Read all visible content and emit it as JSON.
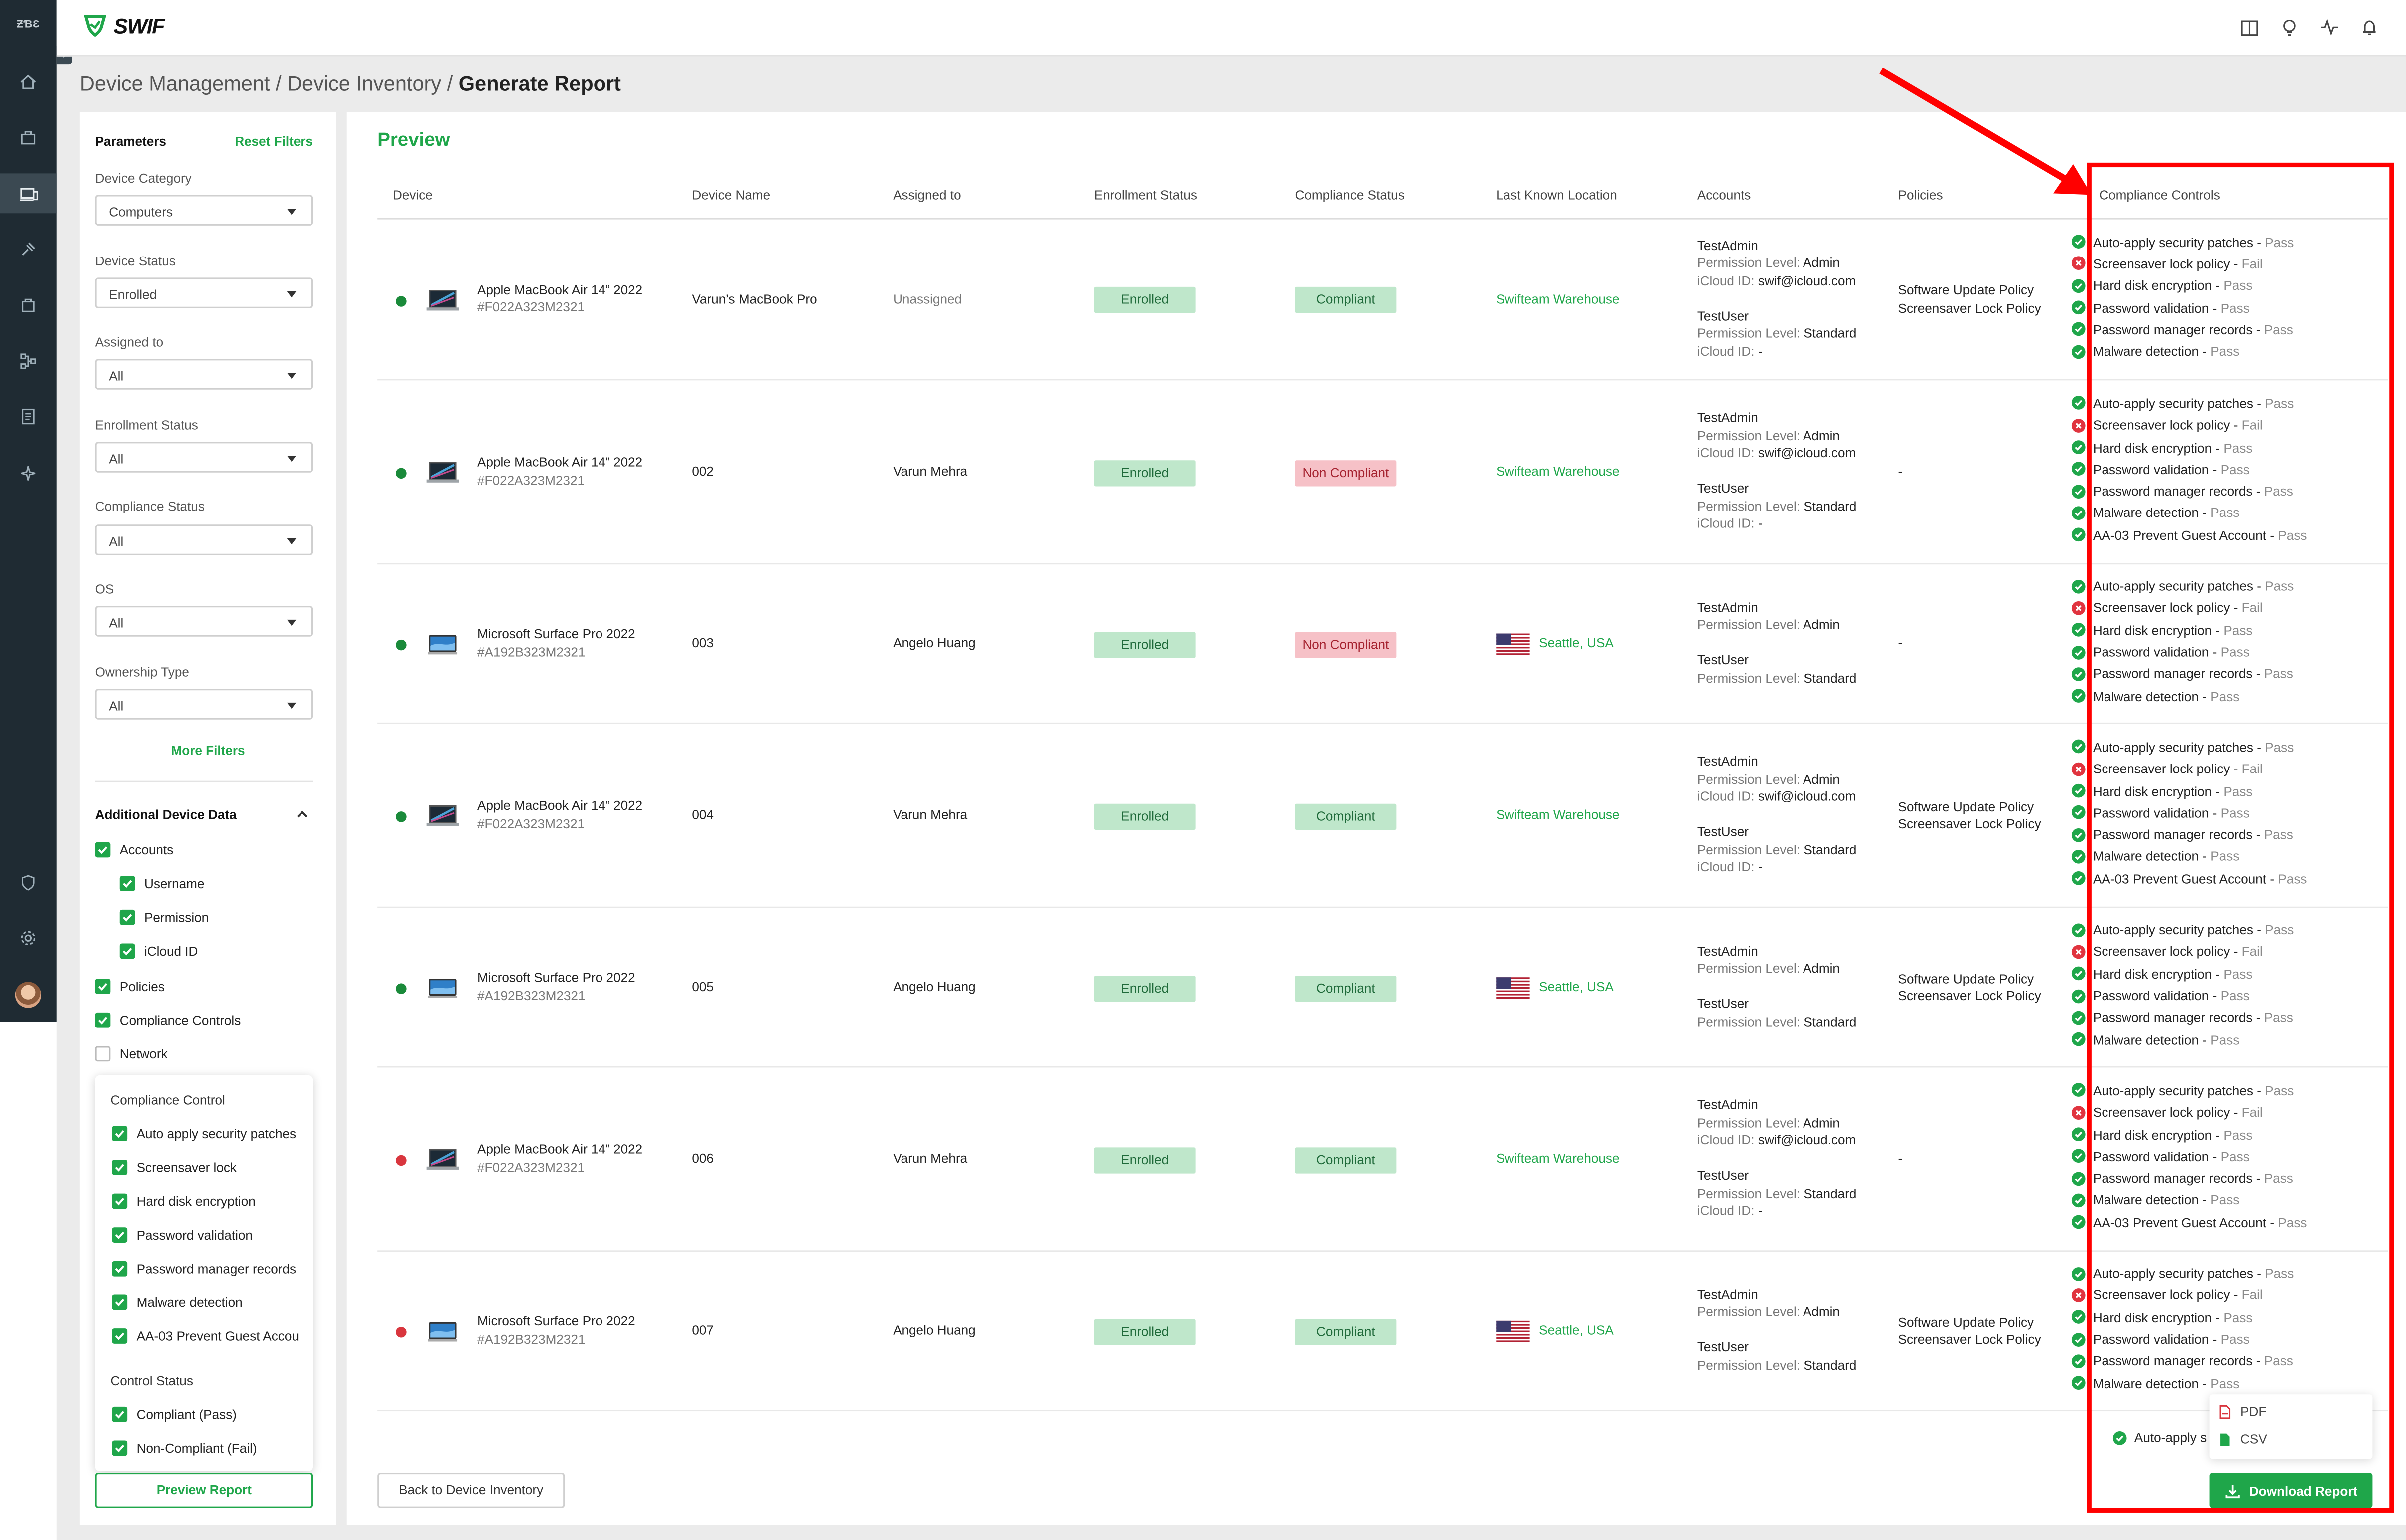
{
  "rail": {
    "org": "ƵƁƐ",
    "items": [
      "home-icon",
      "toolbox-icon",
      "devices-icon",
      "gavel-icon",
      "bag-icon",
      "network-icon",
      "report-icon",
      "sparkle-icon"
    ],
    "bottom": [
      "shield-lock-icon",
      "gear-icon",
      "avatar"
    ]
  },
  "topbar": {
    "logo": "SWIF",
    "icons": [
      "book-icon",
      "bulb-icon",
      "activity-icon",
      "bell-icon"
    ]
  },
  "breadcrumb": {
    "part1": "Device Management / Device Inventory / ",
    "current": "Generate Report"
  },
  "params": {
    "title": "Parameters",
    "reset": "Reset Filters",
    "filters": [
      {
        "label": "Device Category",
        "value": "Computers"
      },
      {
        "label": "Device Status",
        "value": "Enrolled"
      },
      {
        "label": "Assigned to",
        "value": "All"
      },
      {
        "label": "Enrollment Status",
        "value": "All"
      },
      {
        "label": "Compliance Status",
        "value": "All"
      },
      {
        "label": "OS",
        "value": "All"
      },
      {
        "label": "Ownership Type",
        "value": "All"
      }
    ],
    "more_filters": "More Filters",
    "additional_title": "Additional Device Data",
    "additional": [
      {
        "label": "Accounts",
        "checked": true,
        "indent": false
      },
      {
        "label": "Username",
        "checked": true,
        "indent": true
      },
      {
        "label": "Permission",
        "checked": true,
        "indent": true
      },
      {
        "label": "iCloud ID",
        "checked": true,
        "indent": true
      },
      {
        "label": "Policies",
        "checked": true,
        "indent": false
      },
      {
        "label": "Compliance Controls",
        "checked": true,
        "indent": false
      },
      {
        "label": "Network",
        "checked": false,
        "indent": false
      }
    ],
    "compliance_card": {
      "title": "Compliance Control",
      "controls": [
        "Auto apply security patches",
        "Screensaver lock",
        "Hard disk encryption",
        "Password validation",
        "Password manager records",
        "Malware detection",
        "AA-03 Prevent Guest Accou"
      ],
      "status_title": "Control Status",
      "statuses": [
        "Compliant (Pass)",
        "Non-Compliant (Fail)"
      ]
    },
    "preview_button": "Preview Report"
  },
  "preview": {
    "title": "Preview",
    "columns": [
      "Device",
      "Device Name",
      "Assigned to",
      "Enrollment Status",
      "Compliance Status",
      "Last Known Location",
      "Accounts",
      "Policies",
      "Compliance Controls"
    ],
    "rows": [
      {
        "status_color": "#1a8a3a",
        "device_type": "macbook",
        "model": "Apple MacBook Air 14” 2022",
        "serial": "#F022A323M2321",
        "name": "Varun’s MacBook Pro",
        "assigned": "Unassigned",
        "enrollment": "Enrolled",
        "compliance": "Compliant",
        "location": "Swifteam Warehouse",
        "flag": false,
        "accounts": [
          {
            "name": "TestAdmin",
            "perm": "Admin",
            "icloud": "swif@icloud.com"
          },
          {
            "name": "TestUser",
            "perm": "Standard",
            "icloud": "-"
          }
        ],
        "policies": [
          "Software Update Policy",
          "Screensaver Lock Policy"
        ],
        "controls": [
          [
            "Auto-apply security patches",
            "Pass"
          ],
          [
            "Screensaver lock policy",
            "Fail"
          ],
          [
            "Hard disk encryption",
            "Pass"
          ],
          [
            "Password validation",
            "Pass"
          ],
          [
            "Password manager records",
            "Pass"
          ],
          [
            "Malware detection",
            "Pass"
          ]
        ]
      },
      {
        "status_color": "#1a8a3a",
        "device_type": "macbook",
        "model": "Apple MacBook Air 14” 2022",
        "serial": "#F022A323M2321",
        "name": "002",
        "assigned": "Varun Mehra",
        "enrollment": "Enrolled",
        "compliance": "Non Compliant",
        "location": "Swifteam Warehouse",
        "flag": false,
        "accounts": [
          {
            "name": "TestAdmin",
            "perm": "Admin",
            "icloud": "swif@icloud.com"
          },
          {
            "name": "TestUser",
            "perm": "Standard",
            "icloud": "-"
          }
        ],
        "policies": [
          "-"
        ],
        "controls": [
          [
            "Auto-apply security patches",
            "Pass"
          ],
          [
            "Screensaver lock policy",
            "Fail"
          ],
          [
            "Hard disk encryption",
            "Pass"
          ],
          [
            "Password validation",
            "Pass"
          ],
          [
            "Password manager records",
            "Pass"
          ],
          [
            "Malware detection",
            "Pass"
          ],
          [
            "AA-03 Prevent Guest Account",
            "Pass"
          ]
        ]
      },
      {
        "status_color": "#1a8a3a",
        "device_type": "surface",
        "model": "Microsoft Surface Pro 2022",
        "serial": "#A192B323M2321",
        "name": "003",
        "assigned": "Angelo Huang",
        "enrollment": "Enrolled",
        "compliance": "Non Compliant",
        "location": "Seattle, USA",
        "flag": true,
        "accounts": [
          {
            "name": "TestAdmin",
            "perm": "Admin",
            "icloud": null
          },
          {
            "name": "TestUser",
            "perm": "Standard",
            "icloud": null
          }
        ],
        "policies": [
          "-"
        ],
        "controls": [
          [
            "Auto-apply security patches",
            "Pass"
          ],
          [
            "Screensaver lock policy",
            "Fail"
          ],
          [
            "Hard disk encryption",
            "Pass"
          ],
          [
            "Password validation",
            "Pass"
          ],
          [
            "Password manager records",
            "Pass"
          ],
          [
            "Malware detection",
            "Pass"
          ]
        ]
      },
      {
        "status_color": "#1a8a3a",
        "device_type": "macbook",
        "model": "Apple MacBook Air 14” 2022",
        "serial": "#F022A323M2321",
        "name": "004",
        "assigned": "Varun Mehra",
        "enrollment": "Enrolled",
        "compliance": "Compliant",
        "location": "Swifteam Warehouse",
        "flag": false,
        "accounts": [
          {
            "name": "TestAdmin",
            "perm": "Admin",
            "icloud": "swif@icloud.com"
          },
          {
            "name": "TestUser",
            "perm": "Standard",
            "icloud": "-"
          }
        ],
        "policies": [
          "Software Update Policy",
          "Screensaver Lock Policy"
        ],
        "controls": [
          [
            "Auto-apply security patches",
            "Pass"
          ],
          [
            "Screensaver lock policy",
            "Fail"
          ],
          [
            "Hard disk encryption",
            "Pass"
          ],
          [
            "Password validation",
            "Pass"
          ],
          [
            "Password manager records",
            "Pass"
          ],
          [
            "Malware detection",
            "Pass"
          ],
          [
            "AA-03 Prevent Guest Account",
            "Pass"
          ]
        ]
      },
      {
        "status_color": "#1a8a3a",
        "device_type": "surface",
        "model": "Microsoft Surface Pro 2022",
        "serial": "#A192B323M2321",
        "name": "005",
        "assigned": "Angelo Huang",
        "enrollment": "Enrolled",
        "compliance": "Compliant",
        "location": "Seattle, USA",
        "flag": true,
        "accounts": [
          {
            "name": "TestAdmin",
            "perm": "Admin",
            "icloud": null
          },
          {
            "name": "TestUser",
            "perm": "Standard",
            "icloud": null
          }
        ],
        "policies": [
          "Software Update Policy",
          "Screensaver Lock Policy"
        ],
        "controls": [
          [
            "Auto-apply security patches",
            "Pass"
          ],
          [
            "Screensaver lock policy",
            "Fail"
          ],
          [
            "Hard disk encryption",
            "Pass"
          ],
          [
            "Password validation",
            "Pass"
          ],
          [
            "Password manager records",
            "Pass"
          ],
          [
            "Malware detection",
            "Pass"
          ]
        ]
      },
      {
        "status_color": "#d9363e",
        "device_type": "macbook",
        "model": "Apple MacBook Air 14” 2022",
        "serial": "#F022A323M2321",
        "name": "006",
        "assigned": "Varun Mehra",
        "enrollment": "Enrolled",
        "compliance": "Compliant",
        "location": "Swifteam Warehouse",
        "flag": false,
        "accounts": [
          {
            "name": "TestAdmin",
            "perm": "Admin",
            "icloud": "swif@icloud.com"
          },
          {
            "name": "TestUser",
            "perm": "Standard",
            "icloud": "-"
          }
        ],
        "policies": [
          "-"
        ],
        "controls": [
          [
            "Auto-apply security patches",
            "Pass"
          ],
          [
            "Screensaver lock policy",
            "Fail"
          ],
          [
            "Hard disk encryption",
            "Pass"
          ],
          [
            "Password validation",
            "Pass"
          ],
          [
            "Password manager records",
            "Pass"
          ],
          [
            "Malware detection",
            "Pass"
          ],
          [
            "AA-03 Prevent Guest Account",
            "Pass"
          ]
        ]
      },
      {
        "status_color": "#d9363e",
        "device_type": "surface",
        "model": "Microsoft Surface Pro 2022",
        "serial": "#A192B323M2321",
        "name": "007",
        "assigned": "Angelo Huang",
        "enrollment": "Enrolled",
        "compliance": "Compliant",
        "location": "Seattle, USA",
        "flag": true,
        "accounts": [
          {
            "name": "TestAdmin",
            "perm": "Admin",
            "icloud": null
          },
          {
            "name": "TestUser",
            "perm": "Standard",
            "icloud": null
          }
        ],
        "policies": [
          "Software Update Policy",
          "Screensaver Lock Policy"
        ],
        "controls": [
          [
            "Auto-apply security patches",
            "Pass"
          ],
          [
            "Screensaver lock policy",
            "Fail"
          ],
          [
            "Hard disk encryption",
            "Pass"
          ],
          [
            "Password validation",
            "Pass"
          ],
          [
            "Password manager records",
            "Pass"
          ],
          [
            "Malware detection",
            "Pass"
          ]
        ]
      }
    ],
    "permission_label": "Permission Level: ",
    "icloud_label": "iCloud ID: ",
    "peek_text": "Auto-apply s",
    "back_button": "Back to Device Inventory",
    "download_options": [
      "PDF",
      "CSV"
    ],
    "download_button": "Download Report"
  },
  "colors": {
    "accent": "#1fa64a",
    "fail": "#e0343f",
    "annotation": "#ff0000"
  }
}
